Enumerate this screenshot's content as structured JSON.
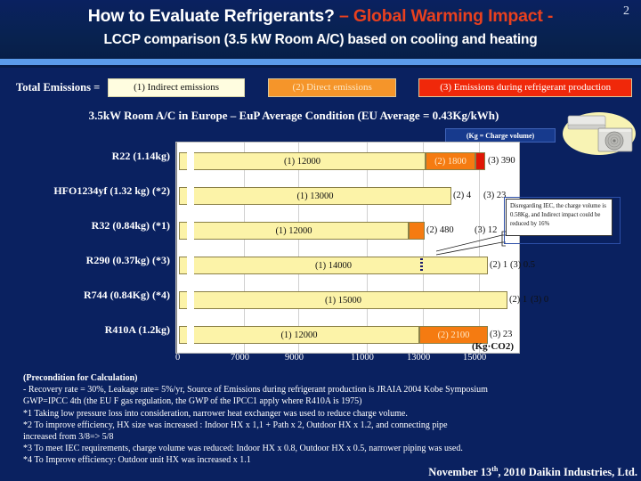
{
  "slide": {
    "number": "2",
    "title_main": "How to Evaluate Refrigerants? ",
    "title_accent": "– Global Warming Impact -",
    "subtitle": "LCCP comparison (3.5 kW Room A/C) based on cooling and heating",
    "chart_subtitle": "3.5kW Room A/C in Europe – EuP Average Condition (EU Average = 0.43Kg/kWh)",
    "kg_note": "(Kg = Charge volume)",
    "unit_label": "(Kg·CO2)",
    "ac_image_name": "air-conditioner-photo"
  },
  "legend": {
    "label": "Total Emissions =",
    "items": [
      {
        "text": "(1) Indirect emissions",
        "color": "#fffde0"
      },
      {
        "text": "(2) Direct emissions",
        "color": "#f5952a"
      },
      {
        "text": "(3) Emissions during refrigerant production",
        "color": "#f0280a"
      }
    ]
  },
  "callout": {
    "text": "Disregarding IEC, the charge volume is 0.58Kg, and Indirect impact could be reduced by 16%"
  },
  "chart_data": {
    "type": "bar",
    "orientation": "horizontal",
    "stacked": true,
    "title": "3.5kW Room A/C in Europe – EuP Average Condition (EU Average = 0.43Kg/kWh)",
    "xlabel": "(Kg·CO2)",
    "ylabel": "",
    "xlim": [
      0,
      16000
    ],
    "axis_break": true,
    "grid": true,
    "legend_position": "top",
    "xticks": [
      0,
      7000,
      9000,
      11000,
      13000,
      15000
    ],
    "xtick_labels": [
      "0",
      "7000",
      "9000",
      "11000",
      "13000",
      "15000"
    ],
    "categories": [
      "R22  (1.14kg)",
      "HFO1234yf (1.32 kg) (*2)",
      "R32 (0.84kg)  (*1)",
      "R290 (0.37kg) (*3)",
      "R744 (0.84Kg) (*4)",
      "R410A  (1.2kg)"
    ],
    "series": [
      {
        "name": "(1) Indirect emissions",
        "color": "#fcf3a8",
        "values": [
          12000,
          13000,
          12000,
          14000,
          15000,
          12000
        ]
      },
      {
        "name": "(2) Direct emissions",
        "color": "#f57b11",
        "values": [
          1800,
          4,
          480,
          1,
          1,
          2100
        ]
      },
      {
        "name": "(3) Emissions during refrigerant production",
        "color": "#e01705",
        "values": [
          390,
          23,
          12,
          0.5,
          0,
          23
        ]
      }
    ],
    "bars": [
      {
        "category": "R22  (1.14kg)",
        "segments": [
          {
            "series": 1,
            "label": "(1) 12000",
            "value": 12000,
            "inside": true
          },
          {
            "series": 2,
            "label": "(2) 1800",
            "value": 1800,
            "inside": true
          },
          {
            "series": 3,
            "label": "",
            "value": 390,
            "inside": true
          }
        ],
        "outside_labels": [
          "(3) 390"
        ]
      },
      {
        "category": "HFO1234yf (1.32 kg) (*2)",
        "segments": [
          {
            "series": 1,
            "label": "(1) 13000",
            "value": 13000,
            "inside": true
          }
        ],
        "outside_labels": [
          "(2) 4",
          "(3) 23"
        ]
      },
      {
        "category": "R32 (0.84kg)  (*1)",
        "segments": [
          {
            "series": 1,
            "label": "(1) 12000",
            "value": 12000,
            "inside": true
          },
          {
            "series": 2,
            "label": "",
            "value": 480,
            "inside": true
          }
        ],
        "outside_labels": [
          "(2) 480",
          "(3) 12"
        ]
      },
      {
        "category": "R290 (0.37kg) (*3)",
        "segments": [
          {
            "series": 1,
            "label": "(1) 14000",
            "value": 14000,
            "inside": true
          }
        ],
        "outside_labels": [
          "(2) 1",
          "(3) 0.5"
        ],
        "marker": "dotted-divider"
      },
      {
        "category": "R744 (0.84Kg) (*4)",
        "segments": [
          {
            "series": 1,
            "label": "(1) 15000",
            "value": 15000,
            "inside": true
          }
        ],
        "outside_labels": [
          "(2) 1",
          "(3) 0"
        ]
      },
      {
        "category": "R410A  (1.2kg)",
        "segments": [
          {
            "series": 1,
            "label": "(1) 12000",
            "value": 12000,
            "inside": true
          },
          {
            "series": 2,
            "label": "(2) 2100",
            "value": 2100,
            "inside": true
          }
        ],
        "outside_labels": [
          "(3) 23"
        ]
      }
    ]
  },
  "footnotes": {
    "heading": "(Precondition for Calculation)",
    "lines": [
      "- Recovery rate = 30%, Leakage rate= 5%/yr, Source of Emissions during refrigerant production is JRAIA 2004 Kobe Symposium",
      "   GWP=IPCC 4th (the EU F gas regulation, the GWP of the IPCC1 apply where R410A is 1975)",
      "*1 Taking low pressure loss into consideration, narrower heat exchanger was used to reduce charge volume.",
      "*2 To improve efficiency, HX size was increased : Indoor HX x 1,1 + Path x 2, Outdoor HX x 1.2, and connecting pipe",
      "      increased from 3/8=> 5/8",
      "*3 To meet IEC requirements, charge volume was reduced: Indoor HX x 0.8, Outdoor HX x 0.5, narrower piping was used.",
      "*4 To Improve efficiency: Outdoor unit HX was increased x 1.1"
    ],
    "credit_pre": "November 13",
    "credit_sup": "th",
    "credit_post": ", 2010 Daikin Industries, Ltd."
  }
}
